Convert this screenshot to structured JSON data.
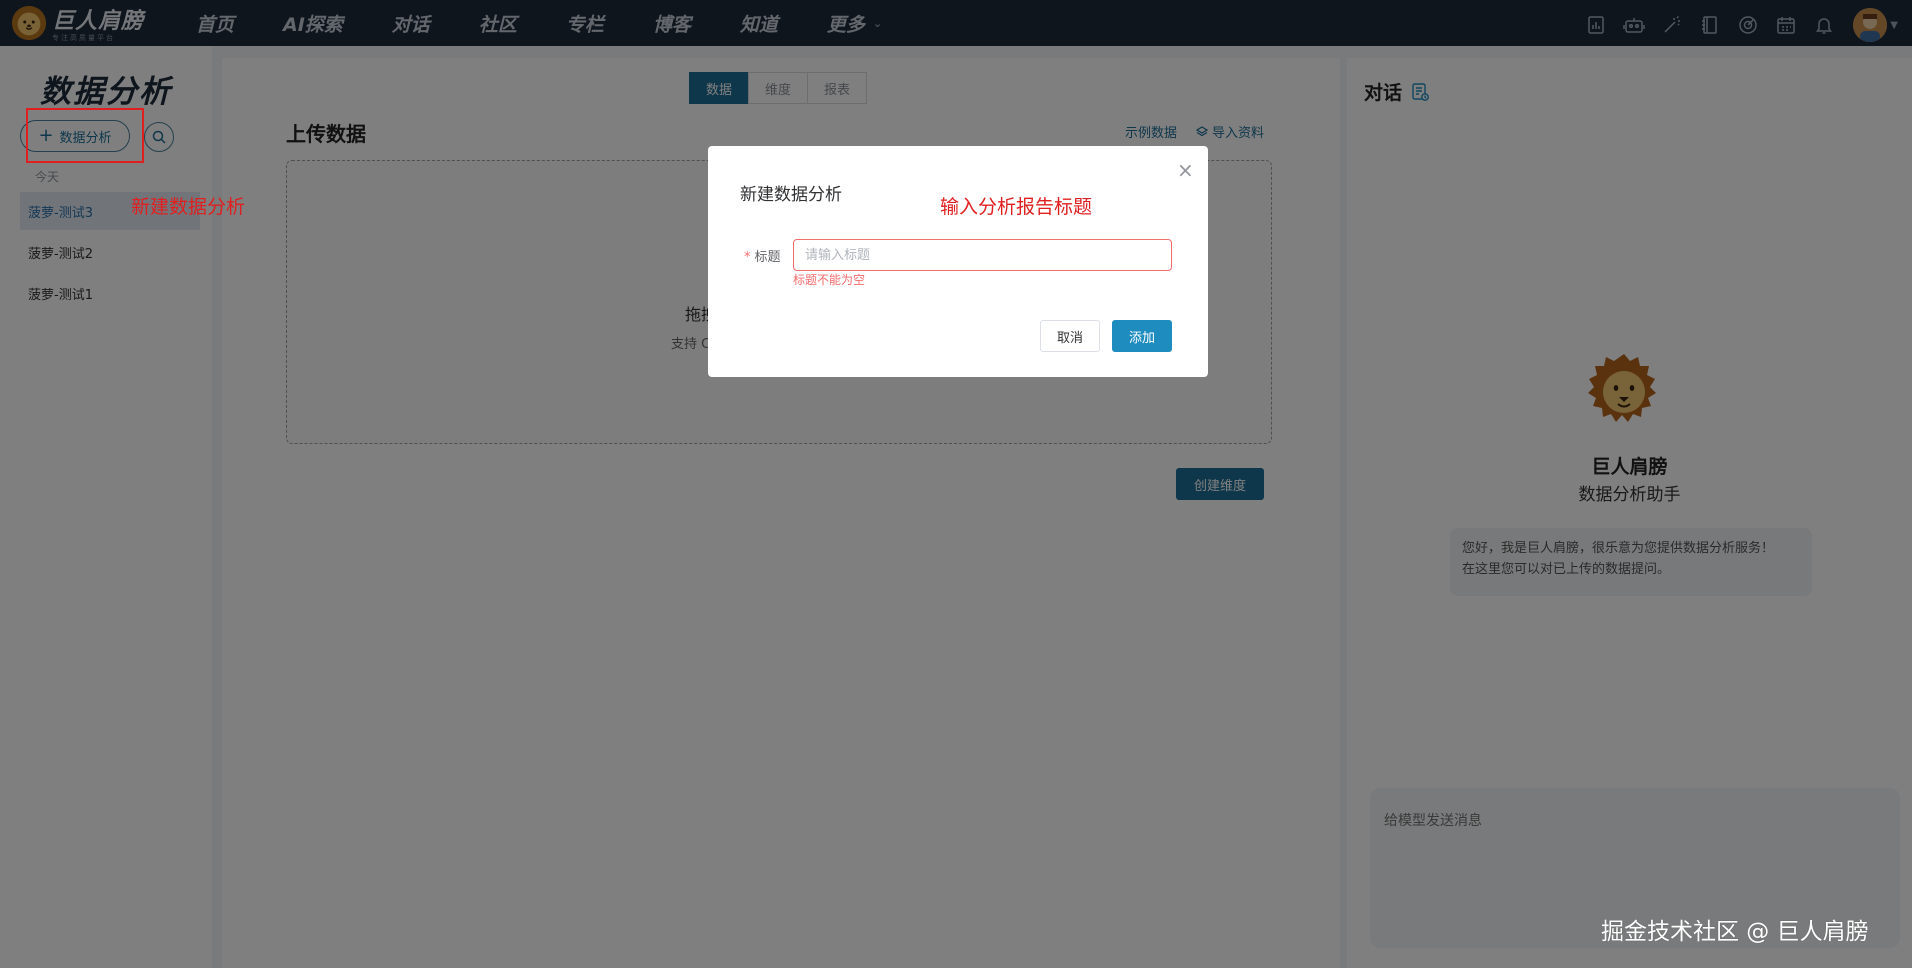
{
  "brand": {
    "name": "巨人肩膀",
    "tagline": "专注高质量平台"
  },
  "nav": {
    "items": [
      "首页",
      "AI探索",
      "对话",
      "社区",
      "专栏",
      "博客",
      "知道"
    ],
    "more_label": "更多"
  },
  "left_panel": {
    "title": "数据分析",
    "new_button_label": "数据分析",
    "group_label": "今天",
    "history": [
      "菠萝-测试3",
      "菠萝-测试2",
      "菠萝-测试1"
    ],
    "annotation": "新建数据分析"
  },
  "main": {
    "tabs": [
      "数据",
      "维度",
      "报表"
    ],
    "active_tab": "数据",
    "upload_title": "上传数据",
    "sample_link": "示例数据",
    "import_link": "导入资料",
    "dropzone_text": "拖拽",
    "dropzone_hint": "支持 CS",
    "create_dimension_label": "创建维度"
  },
  "chat": {
    "title": "对话",
    "bot_name": "巨人肩膀",
    "bot_role": "数据分析助手",
    "greeting_line1": "您好，我是巨人肩膀，很乐意为您提供数据分析服务！",
    "greeting_line2": "在这里您可以对已上传的数据提问。",
    "input_placeholder": "给模型发送消息"
  },
  "dialog": {
    "title": "新建数据分析",
    "annotation": "输入分析报告标题",
    "field_label": "标题",
    "required_mark": "*",
    "input_placeholder": "请输入标题",
    "input_value": "",
    "error_text": "标题不能为空",
    "cancel_label": "取消",
    "add_label": "添加"
  },
  "watermark": "掘金技术社区 @ 巨人肩膀",
  "colors": {
    "topbar": "#1c2a3a",
    "primary": "#1f6f97",
    "dialog_primary": "#1f8cbf",
    "annotation_red": "#e02020",
    "error": "#f56c6c"
  }
}
